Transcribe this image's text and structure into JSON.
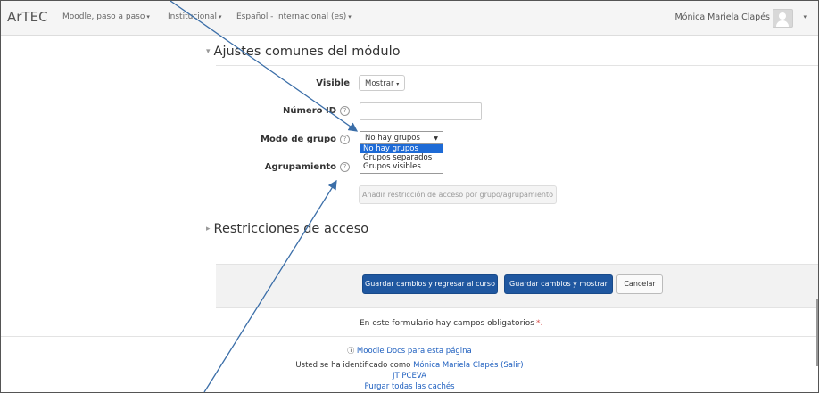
{
  "navbar": {
    "brand": "ArTEC",
    "items": [
      {
        "label": "Moodle, paso a paso"
      },
      {
        "label": "Institucional"
      },
      {
        "label": "Español - Internacional (es)"
      }
    ],
    "user_name": "Mónica Mariela Clapés"
  },
  "sections": {
    "common": "Ajustes comunes del módulo",
    "restrictions": "Restricciones de acceso"
  },
  "form": {
    "visible_label": "Visible",
    "visible_value": "Mostrar",
    "idnumber_label": "Número ID",
    "idnumber_value": "",
    "groupmode_label": "Modo de grupo",
    "groupmode_value": "No hay grupos",
    "groupmode_options": [
      "No hay grupos",
      "Grupos separados",
      "Grupos visibles"
    ],
    "grouping_label": "Agrupamiento",
    "add_restriction_button": "Añadir restricción de acceso por grupo/agrupamiento"
  },
  "actions": {
    "save_return": "Guardar cambios y regresar al curso",
    "save_display": "Guardar cambios y mostrar",
    "cancel": "Cancelar"
  },
  "required_note": "En este formulario hay campos obligatorios",
  "required_star": "*.",
  "footer": {
    "docs_link": "Moodle Docs para esta página",
    "logged_in_prefix": "Usted se ha identificado como",
    "logged_in_user": "Mónica Mariela Clapés",
    "logout": "(Salir)",
    "site_link": "JT PCEVA",
    "purge": "Purgar todas las cachés"
  },
  "colors": {
    "primary_button": "#1f57a0",
    "selected_option": "#1e6bd6",
    "link": "#1e5fbf",
    "annotation_arrow": "#3b6ea8"
  },
  "icons": {
    "help": "question-circle-icon",
    "info": "info-circle-icon",
    "expand": "triangle-icon",
    "avatar": "user-avatar-icon"
  }
}
